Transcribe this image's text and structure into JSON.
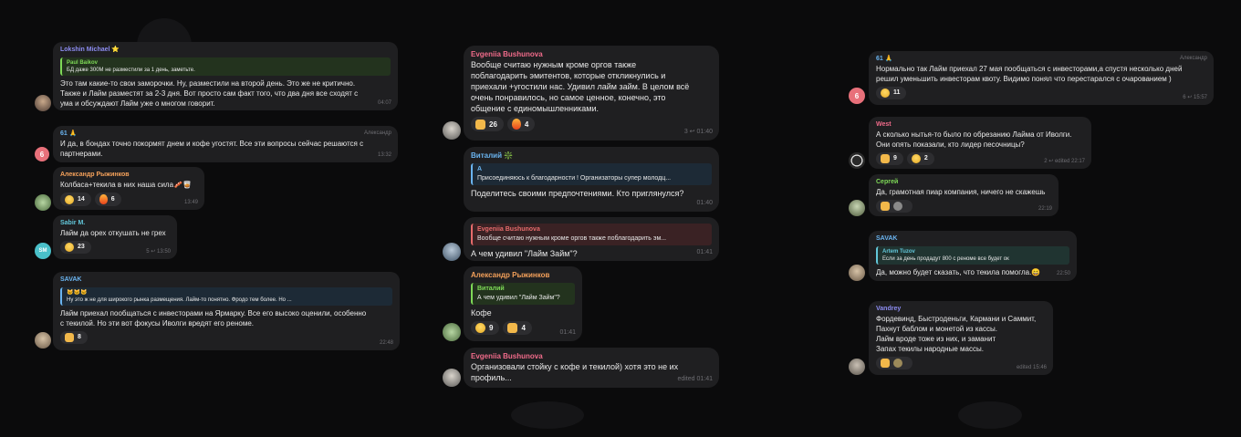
{
  "colors": {
    "background": "#0b0b0c",
    "bubble": "#1f1f21",
    "muted": "#6d6d72",
    "name_violet": "#8c8cf0",
    "name_green": "#7ed957",
    "name_orange": "#f3a05a",
    "name_blue": "#6ab4f0",
    "name_pink": "#f06b8a",
    "name_cyan": "#62c6d9",
    "name_red": "#e66b6b"
  },
  "col1": [
    {
      "author": "Lokshin Michael ⭐",
      "reply": {
        "name": "Paul Baikov",
        "text": "БД даже 300М не разместили за 1 день, заметьте."
      },
      "text": "Это там какие-то свои заморочки. Ну, разместили на второй день. Это же не критично.\nТакже и Лайм разместят за 2-3 дня. Вот просто сам факт того, что два дня все сходят с\nума и обсуждают Лайм уже о многом говорит.",
      "time": "04:07"
    },
    {
      "author": "61 🙏",
      "extra": "Александр",
      "avatar_letter": "6",
      "text": "И да, в бондах точно покормят днем и кофе угостят. Все эти вопросы сейчас решаются с\nпартнерами.",
      "time": "13:32"
    },
    {
      "author": "Александр Рыжинков",
      "text": "Колбаса+текила в них наша сила🥓🥃",
      "reactions": [
        {
          "emoji": "😁",
          "count": "14"
        },
        {
          "emoji": "🔥",
          "count": "6"
        }
      ],
      "time": "13:49"
    },
    {
      "author": "Sabir M.",
      "avatar_letter": "SM",
      "text": "Лайм да орех откушать не грех",
      "reactions": [
        {
          "emoji": "😁",
          "count": "23"
        }
      ],
      "time": "5 ↩ 13:50"
    },
    {
      "author": "SAVAK",
      "reply": {
        "name": "🐱🐱🐱",
        "text": "Ну это ж не для широкого рынка размещения. Лайм-то понятно. Фродо тем более. Но ..."
      },
      "text": "Лайм приехал пообщаться с инвесторами на Ярмарку. Все его высоко оценили, особенно\nс текилой. Но эти вот фокусы Иволги вредят его реноме.",
      "reactions": [
        {
          "emoji": "👍",
          "count": "8"
        }
      ],
      "time": "22:48"
    }
  ],
  "col2": [
    {
      "author": "Evgeniia Bushunova",
      "text": "Вообще считаю нужным кроме оргов также\nпоблагодарить эмитентов, которые откликнулись и\nприехали +угостили нас. Удивил лайм займ. В целом всё\nочень понравилось, но самое ценное, конечно, это\nобщение с единомышленниками.",
      "reactions": [
        {
          "emoji": "👍",
          "count": "26"
        },
        {
          "emoji": "🔥",
          "count": "4"
        }
      ],
      "time": "3 ↩ 01:40"
    },
    {
      "author": "Виталий ❇️",
      "reply": {
        "name": "A",
        "text": "Присоединяюсь к благодарности ! Организаторы супер молодц..."
      },
      "text": "Поделитесь своими предпочтениями. Кто приглянулся?",
      "time": "01:40"
    },
    {
      "reply": {
        "name": "Evgeniia Bushunova",
        "text": "Вообще считаю нужным кроме оргов также поблагодарить эм..."
      },
      "text": "А чем удивил \"Лайм Займ\"?",
      "time": "01:41"
    },
    {
      "author": "Александр Рыжинков",
      "reply": {
        "name": "Виталий",
        "text": "А чем удивил \"Лайм Займ\"?"
      },
      "text": "Кофе",
      "reactions": [
        {
          "emoji": "😁",
          "count": "9"
        },
        {
          "emoji": "👍",
          "count": "4"
        }
      ],
      "time": "01:41"
    },
    {
      "author": "Evgeniia Bushunova",
      "text": "Организовали стойку с кофе и текилой) хотя это не их\nпрофиль...",
      "time": "edited 01:41"
    }
  ],
  "col3": [
    {
      "author": "61 🙏",
      "extra": "Александр",
      "avatar_letter": "6",
      "text": "Нормально так Лайм приехал 27 мая пообщаться с инвесторами,а спустя несколько дней\nрешил уменьшить инвесторам квоту. Видимо понял что перестарался с очарованием )",
      "reactions": [
        {
          "emoji": "😁",
          "count": "11"
        }
      ],
      "time": "6 ↩ 15:57"
    },
    {
      "author": "West",
      "text": "А сколько нытья-то было по обрезанию Лайма от Иволги.\nОни опять показали, кто лидер песочницы?",
      "reactions": [
        {
          "emoji": "👍",
          "count": "9"
        },
        {
          "emoji": "😁",
          "count": "2"
        }
      ],
      "time": "2 ↩ edited 22:17"
    },
    {
      "author": "Сергей",
      "text": "Да, грамотная пиар компания, ничего не скажешь",
      "reactions": [
        {
          "emoji": "👍",
          "count": ""
        }
      ],
      "time": "22:19"
    },
    {
      "author": "SAVAK",
      "reply": {
        "name": "Artem Tuzov",
        "text": "Если за день продадут 800 с реноме все будет ок"
      },
      "text": "Да, можно будет сказать, что текила помогла.😄",
      "time": "22:50"
    },
    {
      "author": "Vandrey",
      "text": "Фордевинд, Быстроденьги, Кармани и Саммит,\nПахнут баблом и монетой из кассы.\nЛайм вроде тоже из них, и заманит\nЗапах текилы народные массы.",
      "reactions": [
        {
          "emoji": "👍",
          "count": ""
        }
      ],
      "time": "edited 15:46"
    }
  ]
}
